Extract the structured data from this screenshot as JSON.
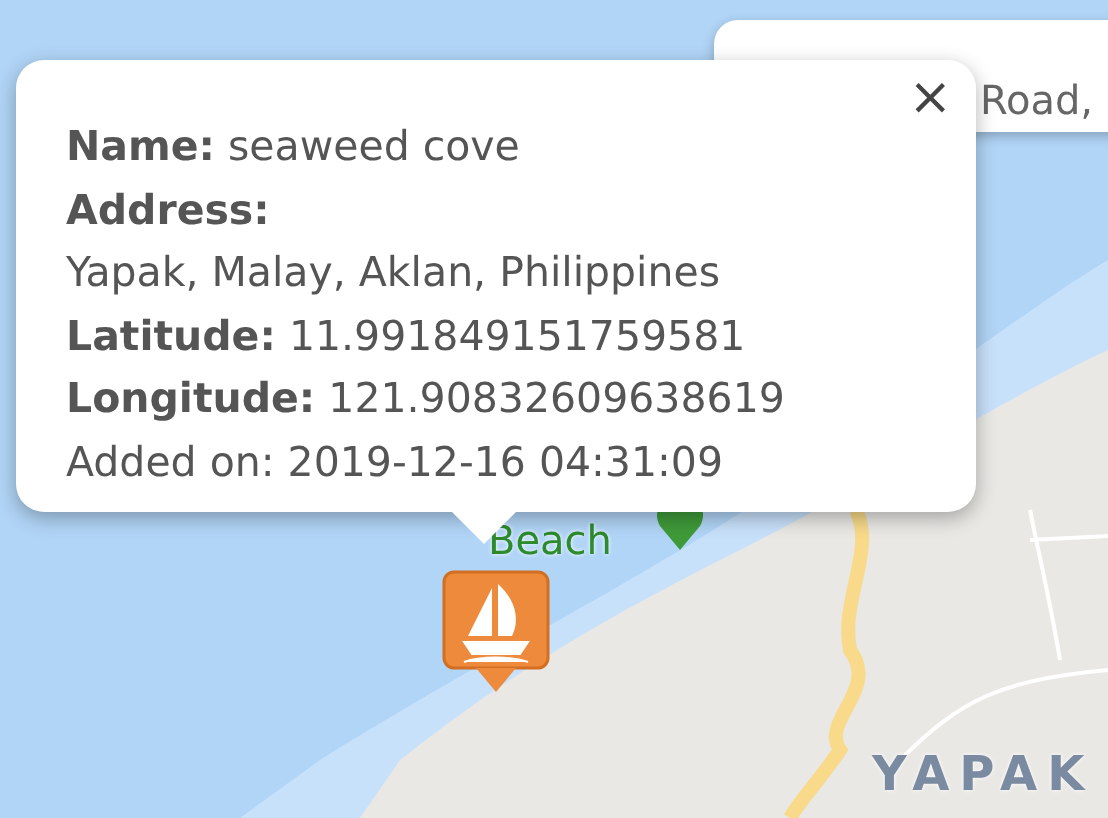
{
  "map_labels": [
    {
      "text": "Beach",
      "kind": "poi"
    },
    {
      "text": "YAPAK",
      "kind": "place"
    }
  ],
  "back_popup": {
    "text": "Road,"
  },
  "popup": {
    "close": "×",
    "fields": [
      {
        "label": "Name:",
        "value": "seaweed cove",
        "kind": "inline"
      },
      {
        "label": "Address:",
        "value": "Yapak, Malay, Aklan, Philippines",
        "kind": "block"
      },
      {
        "label": "Latitude:",
        "value": "11.991849151759581",
        "kind": "inline"
      },
      {
        "label": "Longitude:",
        "value": "121.90832609638619",
        "kind": "inline"
      }
    ],
    "added_on": "Added on: 2019-12-16 04:31:09"
  }
}
